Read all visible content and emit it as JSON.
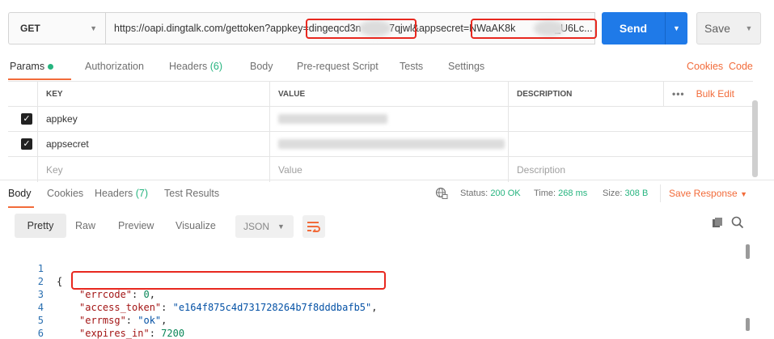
{
  "request": {
    "method": "GET",
    "url": "https://oapi.dingtalk.com/gettoken?appkey=dingeqcd3n          7qjwl&appsecret=NWaAK8k          na_U6Lc...",
    "send_label": "Send",
    "save_label": "Save"
  },
  "request_tabs": {
    "params": "Params",
    "authorization": "Authorization",
    "headers": "Headers",
    "headers_count": "(6)",
    "body": "Body",
    "prerequest": "Pre-request Script",
    "tests": "Tests",
    "settings": "Settings",
    "cookies": "Cookies",
    "code": "Code"
  },
  "params_table": {
    "headers": {
      "key": "KEY",
      "value": "VALUE",
      "description": "DESCRIPTION",
      "more": "•••",
      "bulk_edit": "Bulk Edit"
    },
    "rows": [
      {
        "checked": true,
        "key": "appkey"
      },
      {
        "checked": true,
        "key": "appsecret"
      }
    ],
    "placeholders": {
      "key": "Key",
      "value": "Value",
      "description": "Description"
    }
  },
  "response_tabs": {
    "body": "Body",
    "cookies": "Cookies",
    "headers": "Headers",
    "headers_count": "(7)",
    "test_results": "Test Results",
    "status_label": "Status:",
    "status_value": "200 OK",
    "time_label": "Time:",
    "time_value": "268 ms",
    "size_label": "Size:",
    "size_value": "308 B",
    "save_response": "Save Response"
  },
  "response_toolbar": {
    "pretty": "Pretty",
    "raw": "Raw",
    "preview": "Preview",
    "visualize": "Visualize",
    "format": "JSON"
  },
  "response_body": {
    "lines": [
      {
        "num": "1",
        "open": "{"
      },
      {
        "num": "2",
        "key": "\"errcode\"",
        "num_value": "0",
        "trail": ","
      },
      {
        "num": "3",
        "key": "\"access_token\"",
        "str_value": "\"e164f875c4d731728264b7f8dddbafb5\"",
        "trail": ","
      },
      {
        "num": "4",
        "key": "\"errmsg\"",
        "str_value": "\"ok\"",
        "trail": ","
      },
      {
        "num": "5",
        "key": "\"expires_in\"",
        "num_value": "7200",
        "trail": ""
      },
      {
        "num": "6",
        "close": "}"
      }
    ]
  },
  "colors": {
    "accent_orange": "#f26b3a",
    "send_blue": "#1f7ae8",
    "success_green": "#26b47f",
    "highlight_red": "#e8281f"
  }
}
